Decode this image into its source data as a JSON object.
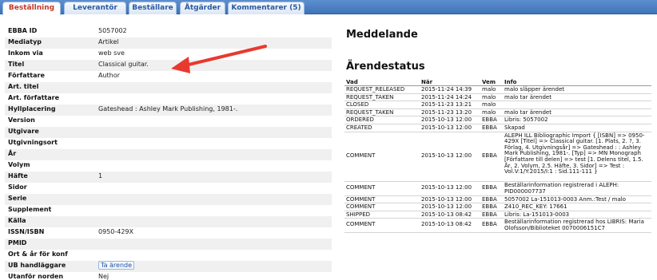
{
  "tabs": [
    {
      "label": "Beställning",
      "active": true
    },
    {
      "label": "Leverantör",
      "active": false
    },
    {
      "label": "Beställare",
      "active": false
    },
    {
      "label": "Åtgärder",
      "active": false
    },
    {
      "label": "Kommentarer (5)",
      "active": false
    }
  ],
  "fields": [
    {
      "label": "EBBA ID",
      "value": "5057002"
    },
    {
      "label": "Mediatyp",
      "value": "Artikel"
    },
    {
      "label": "Inkom via",
      "value": "web sve"
    },
    {
      "label": "Titel",
      "value": "Classical guitar."
    },
    {
      "label": "Författare",
      "value": "Author"
    },
    {
      "label": "Art. titel",
      "value": ""
    },
    {
      "label": "Art. författare",
      "value": ""
    },
    {
      "label": "Hyllplacering",
      "value": "Gateshead : Ashley Mark Publishing, 1981-."
    },
    {
      "label": "Version",
      "value": ""
    },
    {
      "label": "Utgivare",
      "value": ""
    },
    {
      "label": "Utgivningsort",
      "value": ""
    },
    {
      "label": "År",
      "value": ""
    },
    {
      "label": "Volym",
      "value": ""
    },
    {
      "label": "Häfte",
      "value": "1"
    },
    {
      "label": "Sidor",
      "value": ""
    },
    {
      "label": "Serie",
      "value": ""
    },
    {
      "label": "Supplement",
      "value": ""
    },
    {
      "label": "Källa",
      "value": ""
    },
    {
      "label": "ISSN/ISBN",
      "value": "0950-429X"
    },
    {
      "label": "PMID",
      "value": ""
    },
    {
      "label": "Ort & år för konf",
      "value": ""
    },
    {
      "label": "UB handläggare",
      "value": "Ta ärende",
      "link": true
    },
    {
      "label": "Utanför norden",
      "value": "Nej"
    }
  ],
  "message": {
    "heading": "Meddelande"
  },
  "status": {
    "heading": "Ärendestatus",
    "columns": {
      "vad": "Vad",
      "nar": "När",
      "vem": "Vem",
      "info": "Info"
    },
    "rows": [
      {
        "vad": "REQUEST_RELEASED",
        "nar": "2015-11-24 14:39",
        "vem": "malo",
        "info": "malo släpper ärendet",
        "lines": 1
      },
      {
        "vad": "REQUEST_TAKEN",
        "nar": "2015-11-24 14:24",
        "vem": "malo",
        "info": "malo tar ärendet",
        "lines": 1
      },
      {
        "vad": "CLOSED",
        "nar": "2015-11-23 13:21",
        "vem": "malo",
        "info": "",
        "lines": 1
      },
      {
        "vad": "REQUEST_TAKEN",
        "nar": "2015-11-23 13:20",
        "vem": "malo",
        "info": "malo tar ärendet",
        "lines": 1
      },
      {
        "vad": "ORDERED",
        "nar": "2015-10-13 12:00",
        "vem": "EBBA",
        "info": "Libris: 5057002",
        "lines": 1
      },
      {
        "vad": "CREATED",
        "nar": "2015-10-13 12:00",
        "vem": "EBBA",
        "info": "Skapad",
        "lines": 1
      },
      {
        "vad": "COMMENT",
        "nar": "2015-10-13 12:00",
        "vem": "EBBA",
        "info": "ALEPH ILL Bibliographic Import { [ISBN] => 0950-429X [Titel] => Classical guitar. [1. Plats, 2. ?, 3. Förlag, 4. Utgivningsår] => Gateshead : : Ashley Mark Publishing, 1981-. [Typ] => MN Monograph [Författare till delen] => test [1. Delens titel, 1.5. År, 2. Volym, 2.5. Häfte, 3. Sidor] => Test : Vol.V:1/Y:2015/I:1 : Sid.111-111 }",
        "lines": 8
      },
      {
        "vad": "COMMENT",
        "nar": "2015-10-13 12:00",
        "vem": "EBBA",
        "info": "Beställarinformation registrerad i ALEPH: PID000007737",
        "lines": 2
      },
      {
        "vad": "COMMENT",
        "nar": "2015-10-13 12:00",
        "vem": "EBBA",
        "info": "5057002 La-151013-0003 Anm.:Test / malo",
        "lines": 1
      },
      {
        "vad": "COMMENT",
        "nar": "2015-10-13 12:00",
        "vem": "EBBA",
        "info": "Z410_REC_KEY: 17661",
        "lines": 1
      },
      {
        "vad": "SHIPPED",
        "nar": "2015-10-13 08:42",
        "vem": "EBBA",
        "info": "Libris: La-151013-0003",
        "lines": 1
      },
      {
        "vad": "COMMENT",
        "nar": "2015-10-13 08:42",
        "vem": "EBBA",
        "info": "Beställarinformation registrerad hos LIBRIS: Maria Olofsson/Biblioteket 0070006151C7",
        "lines": 2
      }
    ]
  },
  "annotation": {
    "color": "#e8392f"
  }
}
